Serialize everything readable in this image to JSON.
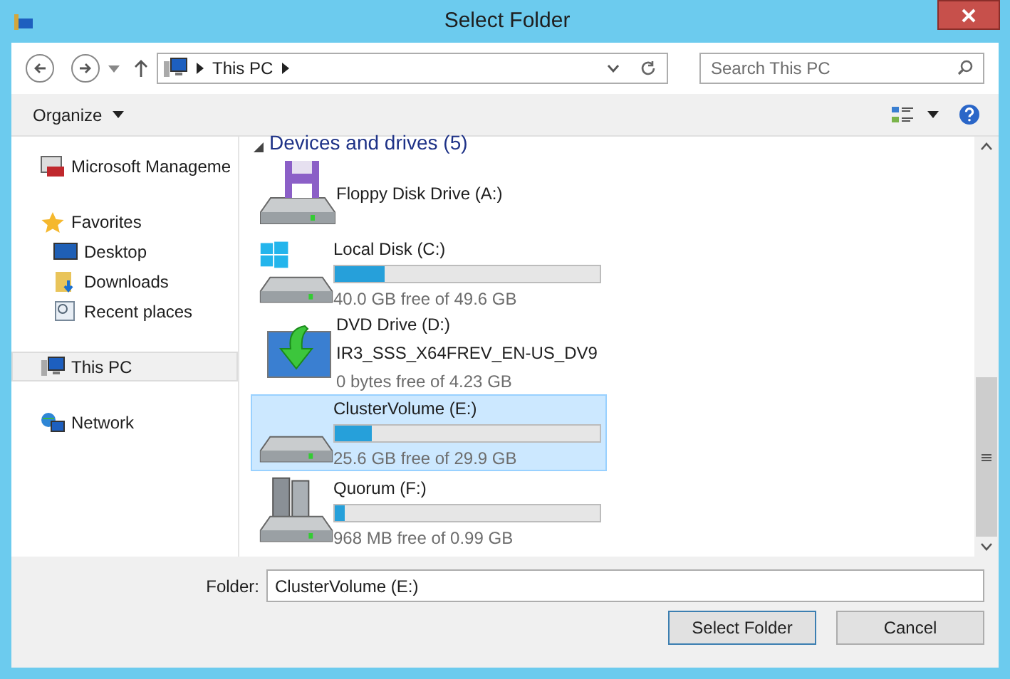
{
  "window": {
    "title": "Select Folder"
  },
  "address": {
    "crumbs": [
      "This PC"
    ]
  },
  "search": {
    "placeholder": "Search This PC"
  },
  "toolbar": {
    "organize": "Organize"
  },
  "sidebar": {
    "items": [
      {
        "label": "Microsoft Manageme",
        "kind": "mmc",
        "selected": false
      },
      {
        "label": "Favorites",
        "kind": "star",
        "selected": false,
        "children": [
          {
            "label": "Desktop",
            "kind": "desktop",
            "selected": false
          },
          {
            "label": "Downloads",
            "kind": "downloads",
            "selected": false
          },
          {
            "label": "Recent places",
            "kind": "recent",
            "selected": false
          }
        ]
      },
      {
        "label": "This PC",
        "kind": "pc",
        "selected": true
      },
      {
        "label": "Network",
        "kind": "network",
        "selected": false
      }
    ]
  },
  "group": {
    "title": "Devices and drives (5)",
    "expanded": true
  },
  "drives": [
    {
      "name": "Floppy Disk Drive (A:)",
      "kind": "floppy",
      "selected": false
    },
    {
      "name": "Local Disk (C:)",
      "kind": "windows",
      "level": 0.19,
      "free": "40.0 GB free of 49.6 GB",
      "selected": false
    },
    {
      "name": "DVD Drive (D:)",
      "kind": "dvd",
      "subtitle": "IR3_SSS_X64FREV_EN-US_DV9",
      "free": "0 bytes free of 4.23 GB",
      "selected": false
    },
    {
      "name": "ClusterVolume (E:)",
      "kind": "disk",
      "level": 0.14,
      "free": "25.6 GB free of 29.9 GB",
      "selected": true
    },
    {
      "name": "Quorum (F:)",
      "kind": "server",
      "level": 0.04,
      "free": "968 MB free of 0.99 GB",
      "selected": false
    }
  ],
  "folder": {
    "label": "Folder:",
    "value": "ClusterVolume (E:)"
  },
  "buttons": [
    "Select Folder",
    "Cancel"
  ]
}
